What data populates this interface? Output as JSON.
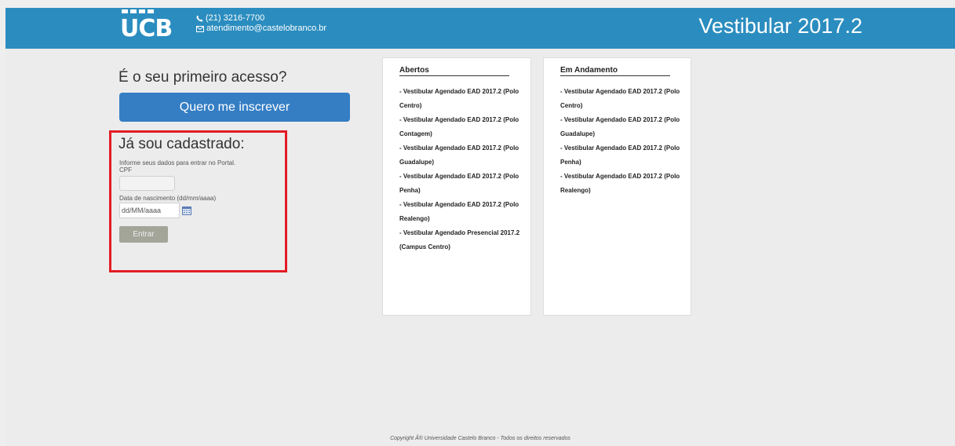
{
  "header": {
    "logo_text": "UCB",
    "phone": "(21) 3216-7700",
    "email": "atendimento@castelobranco.br",
    "title": "Vestibular 2017.2",
    "bg_color": "#2b8dbf"
  },
  "signup": {
    "heading": "É o seu primeiro acesso?",
    "button_label": "Quero me inscrever",
    "button_color": "#357ec4"
  },
  "login": {
    "heading": "Já sou cadastrado:",
    "info": "Informe seus dados para entrar no Portal.",
    "cpf_label": "CPF",
    "cpf_value": "",
    "dob_label": "Data de nascimento (dd/mm/aaaa)",
    "dob_placeholder": "dd/MM/aaaa",
    "submit_label": "Entrar",
    "highlight_color": "#e31c25"
  },
  "panels": {
    "open": {
      "heading": "Abertos",
      "items": [
        "- Vestibular Agendado EAD 2017.2 (Polo Centro)",
        "- Vestibular Agendado EAD 2017.2 (Polo Contagem)",
        "- Vestibular Agendado EAD 2017.2 (Polo Guadalupe)",
        "- Vestibular Agendado EAD 2017.2 (Polo Penha)",
        "- Vestibular Agendado EAD 2017.2 (Polo Realengo)",
        "- Vestibular Agendado Presencial 2017.2 (Campus Centro)"
      ]
    },
    "in_progress": {
      "heading": "Em Andamento",
      "items": [
        "- Vestibular Agendado EAD 2017.2 (Polo Centro)",
        "- Vestibular Agendado EAD 2017.2 (Polo Guadalupe)",
        "- Vestibular Agendado EAD 2017.2 (Polo Penha)",
        "- Vestibular Agendado EAD 2017.2 (Polo Realengo)"
      ]
    }
  },
  "footer": {
    "copyright": "Copyright Â® Universidade Castelo Branco - Todos os direitos reservados"
  }
}
